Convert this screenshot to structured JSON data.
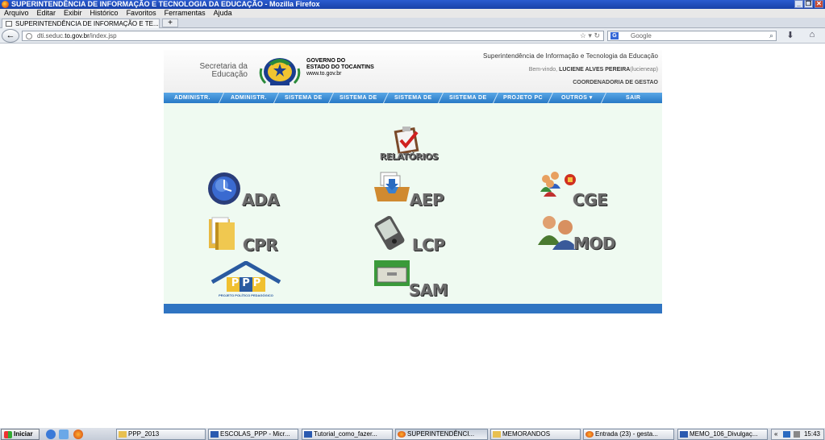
{
  "window": {
    "title": "SUPERINTENDÊNCIA DE INFORMAÇÃO E TECNOLOGIA DA EDUCAÇÃO - Mozilla Firefox",
    "controls": [
      "_",
      "❐",
      "✕"
    ]
  },
  "menubar": [
    "Arquivo",
    "Editar",
    "Exibir",
    "Histórico",
    "Favoritos",
    "Ferramentas",
    "Ajuda"
  ],
  "tab": {
    "title": "SUPERINTENDÊNCIA DE INFORMAÇÃO E TE...",
    "new_tab": "+"
  },
  "nav": {
    "url_prefix": "dti.seduc.",
    "url_domain": "to.gov.br",
    "url_path": "/index.jsp",
    "search_placeholder": "Google",
    "search_engine_icon": "G"
  },
  "header": {
    "secretaria": "Secretaria da Educação",
    "gov_line1": "GOVERNO DO",
    "gov_line2": "ESTADO DO TOCANTINS",
    "gov_url": "www.to.gov.br",
    "superintendencia": "Superintendência de Informação e Tecnologia da Educação",
    "welcome_prefix": "Bem-vindo, ",
    "user_name": "LUCIENE ALVES PEREIRA",
    "user_login": "(lucieneap)",
    "coordenadoria": "COORDENADORIA DE GESTAO"
  },
  "menu": [
    {
      "label": "ADMINISTR."
    },
    {
      "label": "ADMINISTR."
    },
    {
      "label": "SISTEMA DE"
    },
    {
      "label": "SISTEMA DE"
    },
    {
      "label": "SISTEMA DE"
    },
    {
      "label": "SISTEMA DE"
    },
    {
      "label": "PROJETO PC"
    },
    {
      "label": "OUTROS ▾"
    },
    {
      "label": "SAIR"
    }
  ],
  "apps": {
    "relatorios": "RELATÓRIOS",
    "ada": "ADA",
    "aep": "AEP",
    "cge": "CGE",
    "cpr": "CPR",
    "lcp": "LCP",
    "mod": "MOD",
    "sam": "SAM",
    "ppp_logo_text": "PPP",
    "ppp_caption": "PROJETO POLÍTICO PEDAGÓGICO"
  },
  "colors": {
    "menu_blue": "#2778c5",
    "content_bg": "#effaf1",
    "footer_blue": "#2f74c2"
  },
  "taskbar": {
    "start": "Iniciar",
    "items": [
      {
        "label": "PPP_2013",
        "icon": "folder-icon"
      },
      {
        "label": "ESCOLAS_PPP - Micr...",
        "icon": "word-icon"
      },
      {
        "label": "Tutorial_como_fazer...",
        "icon": "word-icon"
      },
      {
        "label": "SUPERINTENDÊNCI...",
        "icon": "firefox-icon"
      },
      {
        "label": "MEMORANDOS",
        "icon": "folder-icon"
      },
      {
        "label": "Entrada (23) - gesta...",
        "icon": "firefox-icon"
      },
      {
        "label": "MEMO_106_Divulgaç...",
        "icon": "word-icon"
      }
    ],
    "tray_arrows": "«",
    "clock": "15:43"
  }
}
